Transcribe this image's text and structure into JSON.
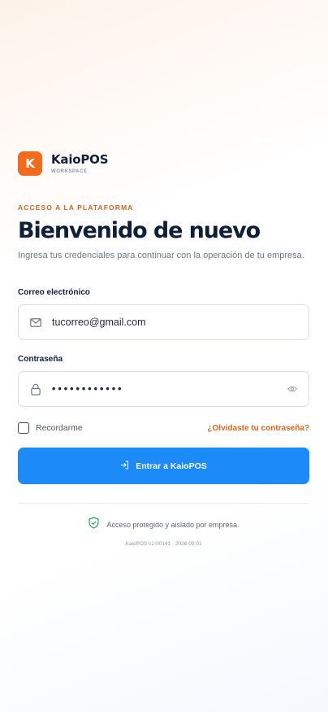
{
  "brand": {
    "logo_letter": "K",
    "name": "KaioPOS",
    "sub": "WORKSPACE"
  },
  "login": {
    "eyebrow": "ACCESO A LA PLATAFORMA",
    "title": "Bienvenido de nuevo",
    "subtitle": "Ingresa tus credenciales para continuar con la operación de tu empresa.",
    "email_label": "Correo electrónico",
    "email_value": "tucorreo@gmail.com",
    "password_label": "Contraseña",
    "password_value": "••••••••••••",
    "remember_label": "Recordarme",
    "forgot_label": "¿Olvidaste tu contraseña?",
    "submit_label": "Entrar a KaioPOS"
  },
  "footer": {
    "secure_text": "Acceso protegido y aislado por empresa.",
    "version": "KaioPOS v1-00141 · 2026.09.01"
  },
  "icons": {
    "email": "mail-icon",
    "password": "lock-icon",
    "toggle_password": "eye-icon",
    "submit": "login-icon",
    "secure": "shield-check-icon"
  },
  "colors": {
    "brand_orange": "#f26a1b",
    "primary_blue": "#1c8bf7",
    "heading": "#0f1e3a",
    "secure_green": "#22a05a"
  }
}
